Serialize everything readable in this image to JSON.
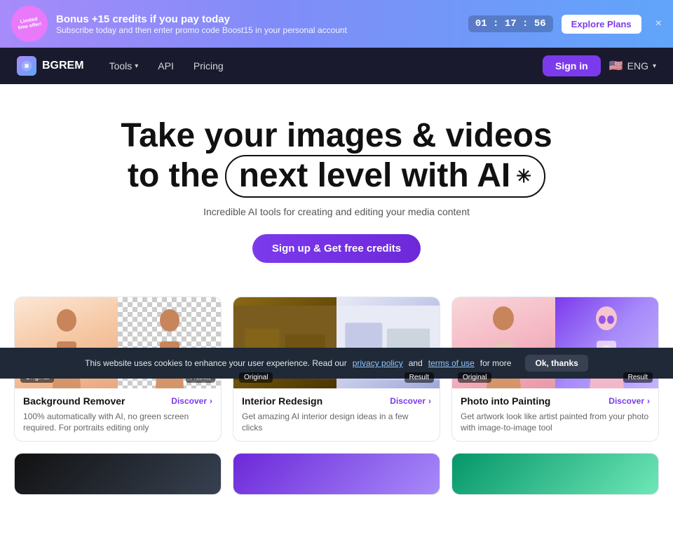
{
  "banner": {
    "badge_line1": "Limited",
    "badge_line2": "time offer!",
    "title": "Bonus +15 credits if you pay today",
    "subtitle": "Subscribe today and then enter promo code Boost15 in your personal account",
    "timer": "01 : 17 : 56",
    "cta_label": "Explore Plans",
    "close_label": "×"
  },
  "nav": {
    "logo_text": "BGREM",
    "tools_label": "Tools",
    "api_label": "API",
    "pricing_label": "Pricing",
    "signin_label": "Sign in",
    "lang_label": "ENG",
    "flag": "🇺🇸"
  },
  "hero": {
    "line1": "Take your images & videos",
    "line2_prefix": "to the",
    "highlight": "next level with AI",
    "subtitle": "Incredible AI tools for creating and editing your media content",
    "cta_label": "Sign up & Get free credits"
  },
  "cards": [
    {
      "title": "Background Remover",
      "discover": "Discover",
      "description": "100% automatically with AI, no green screen required. For portraits editing only",
      "label_original": "Original",
      "label_result": "Result"
    },
    {
      "title": "Interior Redesign",
      "discover": "Discover",
      "description": "Get amazing AI interior design ideas in a few clicks",
      "label_original": "Original",
      "label_result": "Result"
    },
    {
      "title": "Photo into Painting",
      "discover": "Discover",
      "description": "Get artwork look like artist painted from your photo with image-to-image tool",
      "label_original": "Original",
      "label_result": "Result"
    }
  ],
  "cookie": {
    "text": "This website uses cookies to enhance your user experience. Read our",
    "privacy_label": "privacy policy",
    "and": "and",
    "terms_label": "terms of use",
    "suffix": "for more",
    "ok_label": "Ok, thanks"
  }
}
